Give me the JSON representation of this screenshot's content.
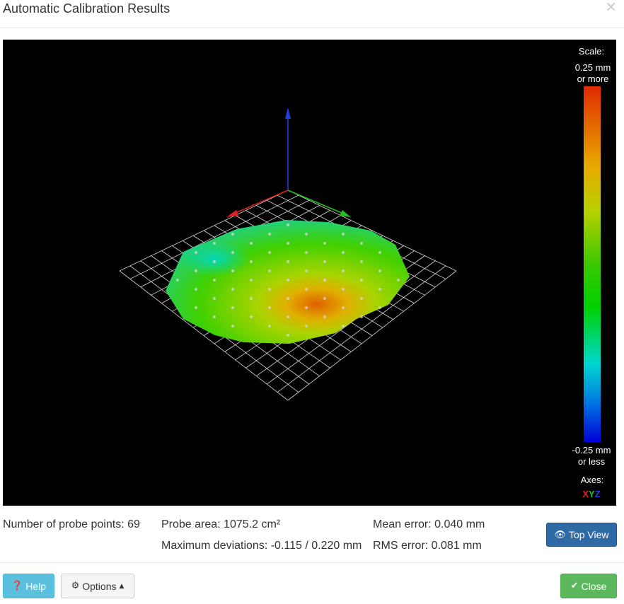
{
  "dialog": {
    "title": "Automatic Calibration Results",
    "close_glyph": "×"
  },
  "scale": {
    "title": "Scale:",
    "top_label_line1": "0.25 mm",
    "top_label_line2": "or more",
    "bottom_label_line1": "-0.25 mm",
    "bottom_label_line2": "or less",
    "axes_title": "Axes:",
    "axis_x": "X",
    "axis_y": "Y",
    "axis_z": "Z"
  },
  "stats": {
    "probe_points": "Number of probe points: 69",
    "probe_area": "Probe area: 1075.2 cm²",
    "max_deviations": "Maximum deviations: -0.115 / 0.220 mm",
    "mean_error": "Mean error: 0.040 mm",
    "rms_error": "RMS error: 0.081 mm"
  },
  "buttons": {
    "top_view": "Top View",
    "help": "Help",
    "options": "Options",
    "close": "Close"
  },
  "icons": {
    "eye": "eye-icon",
    "help": "question-circle-icon",
    "gear": "gear-icon",
    "caret": "caret-up-icon",
    "check": "check-icon"
  },
  "colors": {
    "primary": "#2e6aa6",
    "info": "#5bc0de",
    "success": "#5cb85c",
    "axis_x": "#e02020",
    "axis_y": "#20c020",
    "axis_z": "#2040e0"
  }
}
